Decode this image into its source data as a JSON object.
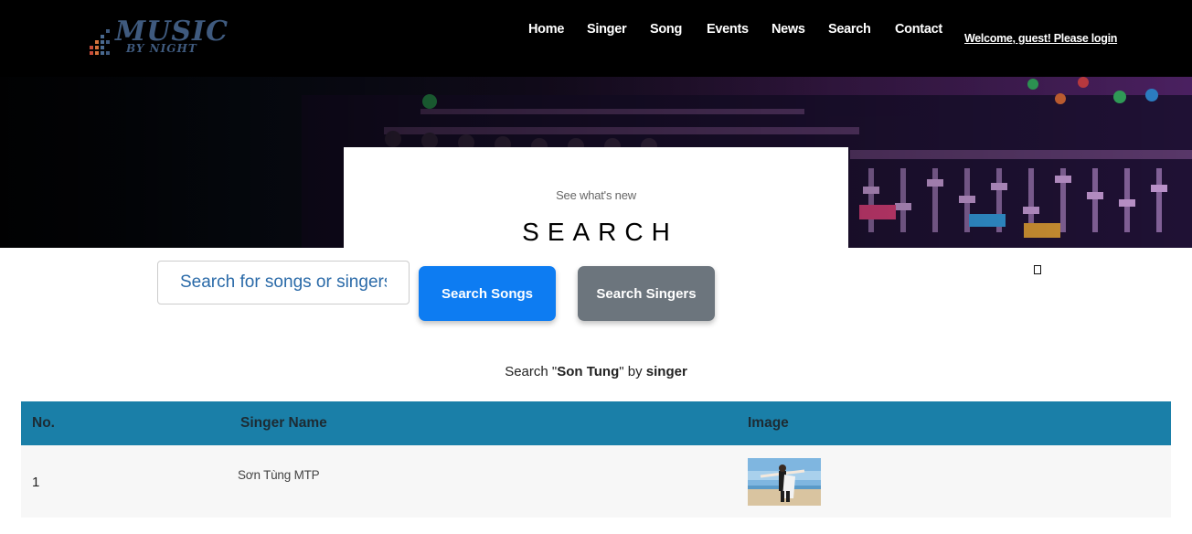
{
  "logo": {
    "line1": "MUSIC",
    "line2": "BY NIGHT"
  },
  "nav": {
    "items": [
      {
        "label": "Home"
      },
      {
        "label": "Singer"
      },
      {
        "label": "Song"
      },
      {
        "label": "Events"
      },
      {
        "label": "News"
      },
      {
        "label": "Search"
      },
      {
        "label": "Contact"
      }
    ],
    "welcome": "Welcome, guest! Please login"
  },
  "hero": {
    "subtitle": "See what's new",
    "title": "SEARCH"
  },
  "search": {
    "placeholder": "Search for songs or singers",
    "songs_button": "Search Songs",
    "singers_button": "Search Singers"
  },
  "result": {
    "prefix": "Search \"",
    "query": "Son Tung",
    "middle": "\" by ",
    "type": "singer"
  },
  "table": {
    "headers": [
      "No.",
      "Singer Name",
      "Image"
    ],
    "rows": [
      {
        "no": "1",
        "name": "Sơn Tùng MTP"
      }
    ]
  }
}
